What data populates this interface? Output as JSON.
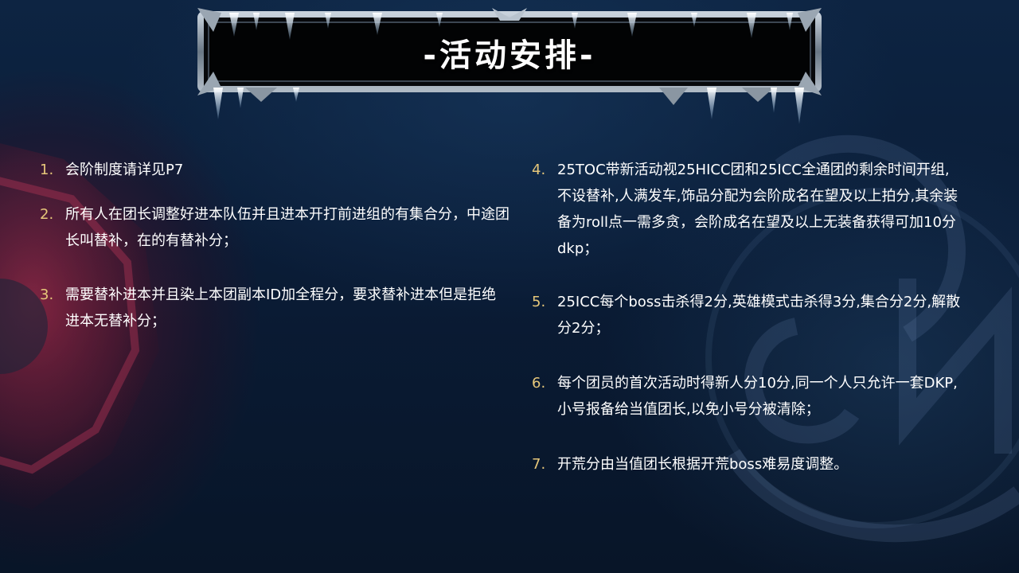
{
  "slide": {
    "title": "-活动安排-",
    "accent_color": "#e6c77a",
    "text_color": "#ffffff",
    "background_color": "#0b1a30"
  },
  "left_column": {
    "items": [
      {
        "number": "1.",
        "text": "会阶制度请详见P7"
      },
      {
        "number": "2.",
        "text": "所有人在团长调整好进本队伍并且进本开打前进组的有集合分，中途团长叫替补，在的有替补分；"
      },
      {
        "number": "3.",
        "text": "需要替补进本并且染上本团副本ID加全程分，要求替补进本但是拒绝进本无替补分；"
      }
    ]
  },
  "right_column": {
    "items": [
      {
        "number": "4.",
        "text": "25TOC带新活动视25HICC团和25ICC全通团的剩余时间开组,不设替补,人满发车,饰品分配为会阶成名在望及以上拍分,其余装备为roll点一需多贪，会阶成名在望及以上无装备获得可加10分dkp；"
      },
      {
        "number": "5.",
        "text": "25ICC每个boss击杀得2分,英雄模式击杀得3分,集合分2分,解散分2分；"
      },
      {
        "number": "6.",
        "text": "每个团员的首次活动时得新人分10分,同一个人只允许一套DKP,小号报备给当值团长,以免小号分被清除；"
      },
      {
        "number": "7.",
        "text": "开荒分由当值团长根据开荒boss难易度调整。"
      }
    ]
  },
  "icons": {
    "title_frame": "frozen-frame-icon",
    "background_left": "horde-emblem-icon",
    "background_right": "cn-reunion-logo-icon"
  }
}
